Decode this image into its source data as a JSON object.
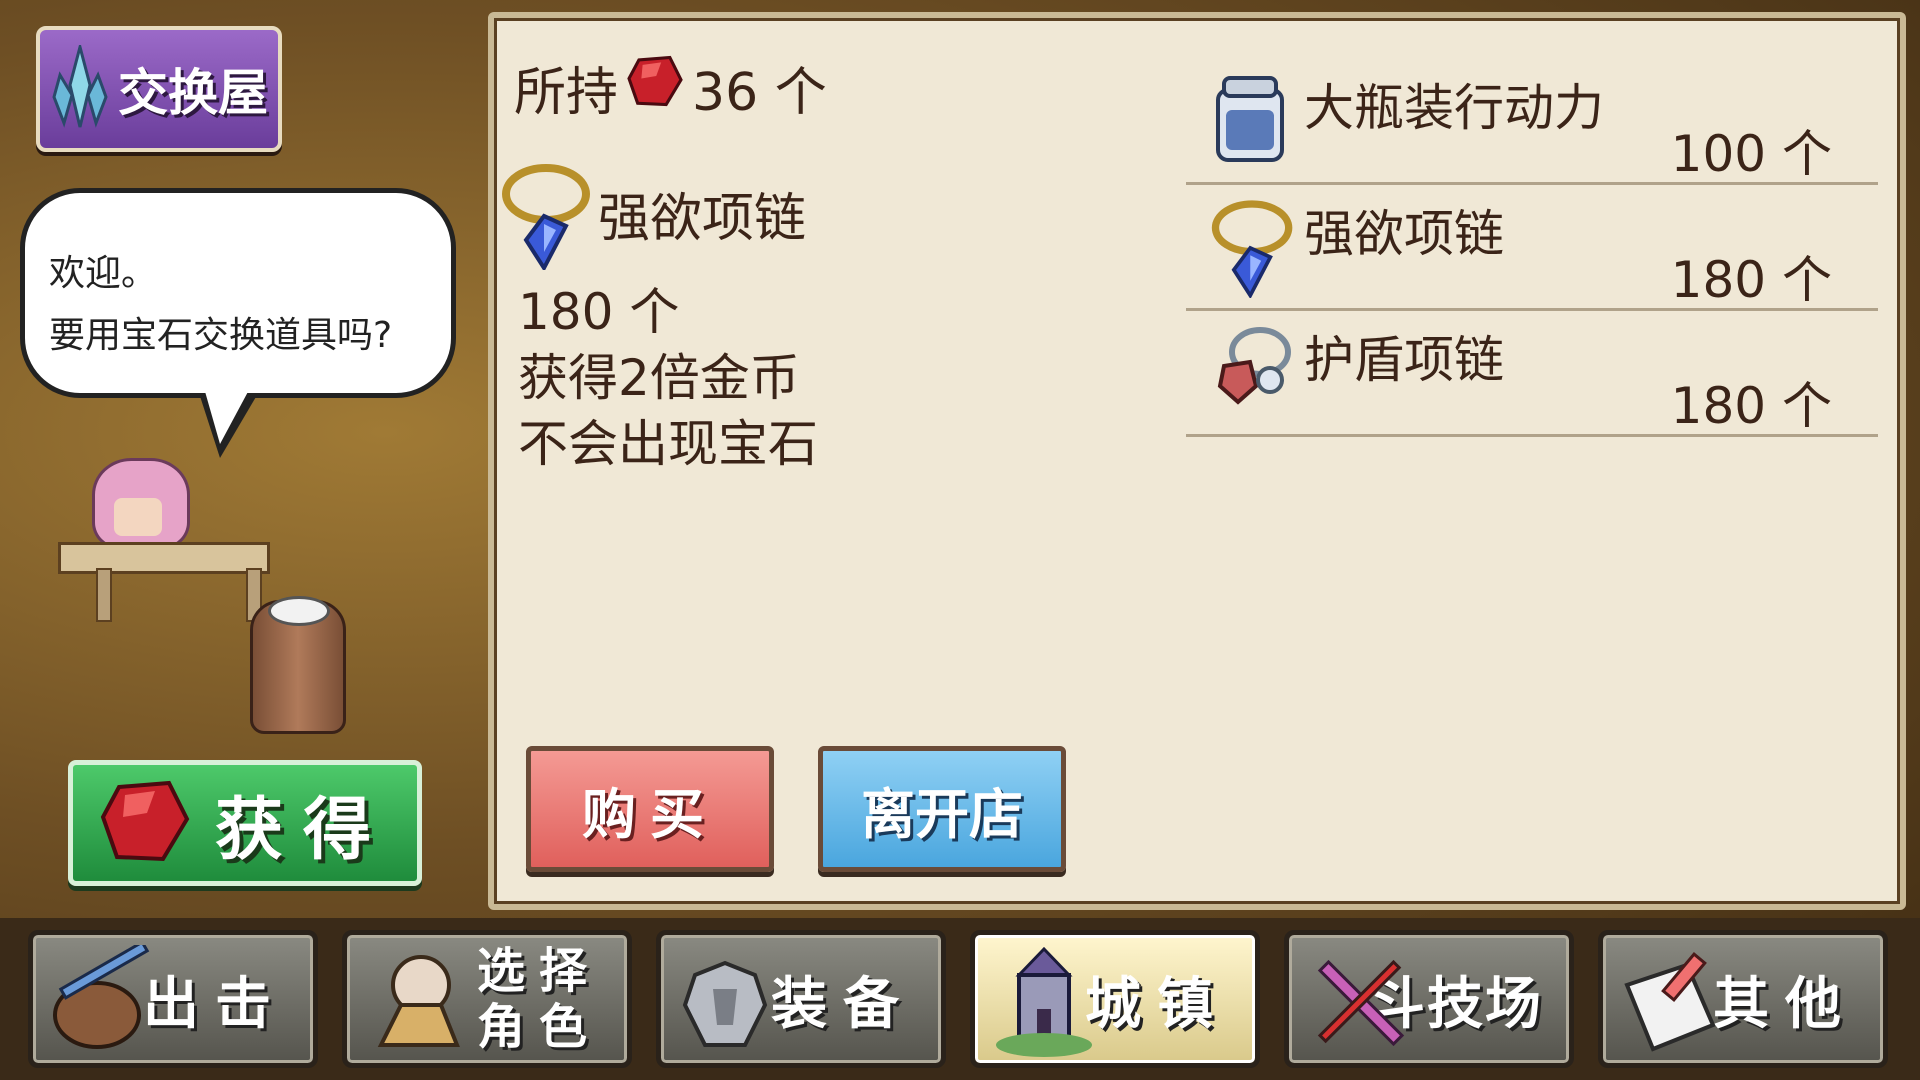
{
  "shop": {
    "title": "交换屋",
    "icon": "crystal-icon"
  },
  "npc_dialog": {
    "line1": "欢迎。",
    "line2": "要用宝石交换道具吗?"
  },
  "obtain_button": {
    "label": "获得",
    "icon": "red-gem-icon"
  },
  "held": {
    "prefix": "所持",
    "count": "36 个",
    "icon": "red-gem-icon"
  },
  "selected_item": {
    "name": "强欲项链",
    "price": "180 个",
    "effect1": "获得2倍金币",
    "effect2": "不会出现宝石",
    "icon": "necklace-icon"
  },
  "items": [
    {
      "name": "大瓶装行动力",
      "price": "100 个",
      "icon": "bottle-icon"
    },
    {
      "name": "强欲项链",
      "price": "180 个",
      "icon": "necklace-icon"
    },
    {
      "name": "护盾项链",
      "price": "180 个",
      "icon": "shield-necklace-icon"
    }
  ],
  "buttons": {
    "buy": "购买",
    "leave": "离开店"
  },
  "nav": [
    {
      "label": "出击",
      "icon": "sortie-icon"
    },
    {
      "label_line1": "选择",
      "label_line2": "角色",
      "icon": "character-icon"
    },
    {
      "label": "装备",
      "icon": "armor-icon"
    },
    {
      "label": "城镇",
      "icon": "castle-icon",
      "active": true
    },
    {
      "label": "斗技场",
      "icon": "sword-icon"
    },
    {
      "label": "其他",
      "icon": "scroll-icon"
    }
  ],
  "colors": {
    "gem": "#c8202a",
    "panel": "#f0e8d6",
    "text": "#3b2418"
  }
}
